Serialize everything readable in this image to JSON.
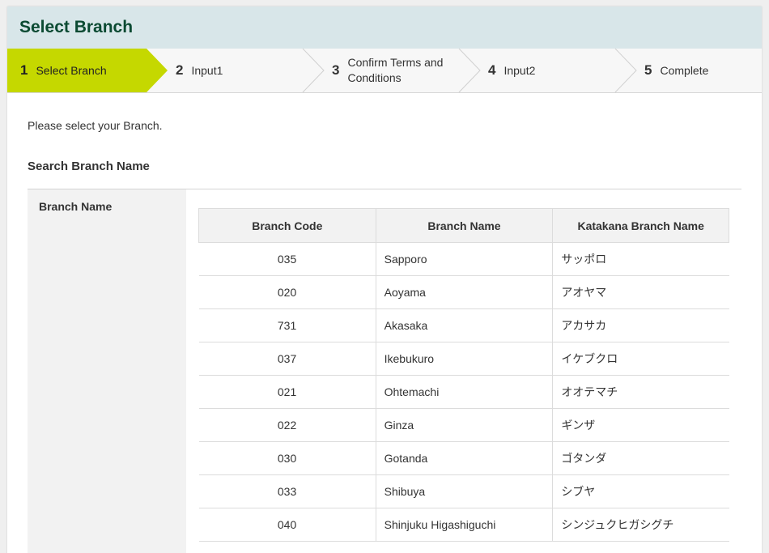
{
  "header": {
    "title": "Select Branch"
  },
  "steps": [
    {
      "num": "1",
      "label": "Select Branch"
    },
    {
      "num": "2",
      "label": "Input1"
    },
    {
      "num": "3",
      "label": "Confirm Terms and Conditions"
    },
    {
      "num": "4",
      "label": "Input2"
    },
    {
      "num": "5",
      "label": "Complete"
    }
  ],
  "colors": {
    "active_step": "#c5d800",
    "header_bg": "#d8e6e9",
    "title": "#0b4a32"
  },
  "intro": "Please select your Branch.",
  "search": {
    "title": "Search Branch Name",
    "field_label": "Branch Name"
  },
  "table": {
    "headers": [
      "Branch Code",
      "Branch Name",
      "Katakana Branch Name"
    ],
    "rows": [
      [
        "035",
        "Sapporo",
        "サッポロ"
      ],
      [
        "020",
        "Aoyama",
        "アオヤマ"
      ],
      [
        "731",
        "Akasaka",
        "アカサカ"
      ],
      [
        "037",
        "Ikebukuro",
        "イケブクロ"
      ],
      [
        "021",
        "Ohtemachi",
        "オオテマチ"
      ],
      [
        "022",
        "Ginza",
        "ギンザ"
      ],
      [
        "030",
        "Gotanda",
        "ゴタンダ"
      ],
      [
        "033",
        "Shibuya",
        "シブヤ"
      ],
      [
        "040",
        "Shinjuku Higashiguchi",
        "シンジュクヒガシグチ"
      ]
    ]
  }
}
